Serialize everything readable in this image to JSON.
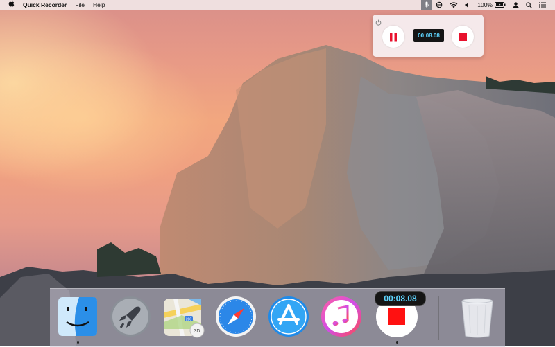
{
  "menubar": {
    "apple_icon": "apple-icon",
    "app_name": "Quick Recorder",
    "menus": [
      "File",
      "Help"
    ],
    "status": {
      "battery_percent": "100%",
      "icons": [
        "microphone-icon",
        "sync-icon",
        "wifi-icon",
        "volume-icon",
        "battery-icon",
        "user-icon",
        "search-icon",
        "list-icon"
      ]
    }
  },
  "recorder_panel": {
    "timer": "00:08.08",
    "buttons": [
      "power-icon",
      "pause-icon",
      "stop-icon"
    ],
    "accent": "#e8112d"
  },
  "dock": {
    "items": [
      "Finder",
      "Launchpad",
      "Maps",
      "Safari",
      "App Store",
      "iTunes",
      "Quick Recorder",
      "Trash"
    ],
    "recorder_badge": "00:08.08",
    "maps_badge": "3D",
    "maps_route": "280"
  },
  "colors": {
    "timer_text": "#5fd5ff",
    "recording_red": "#ff1111"
  }
}
